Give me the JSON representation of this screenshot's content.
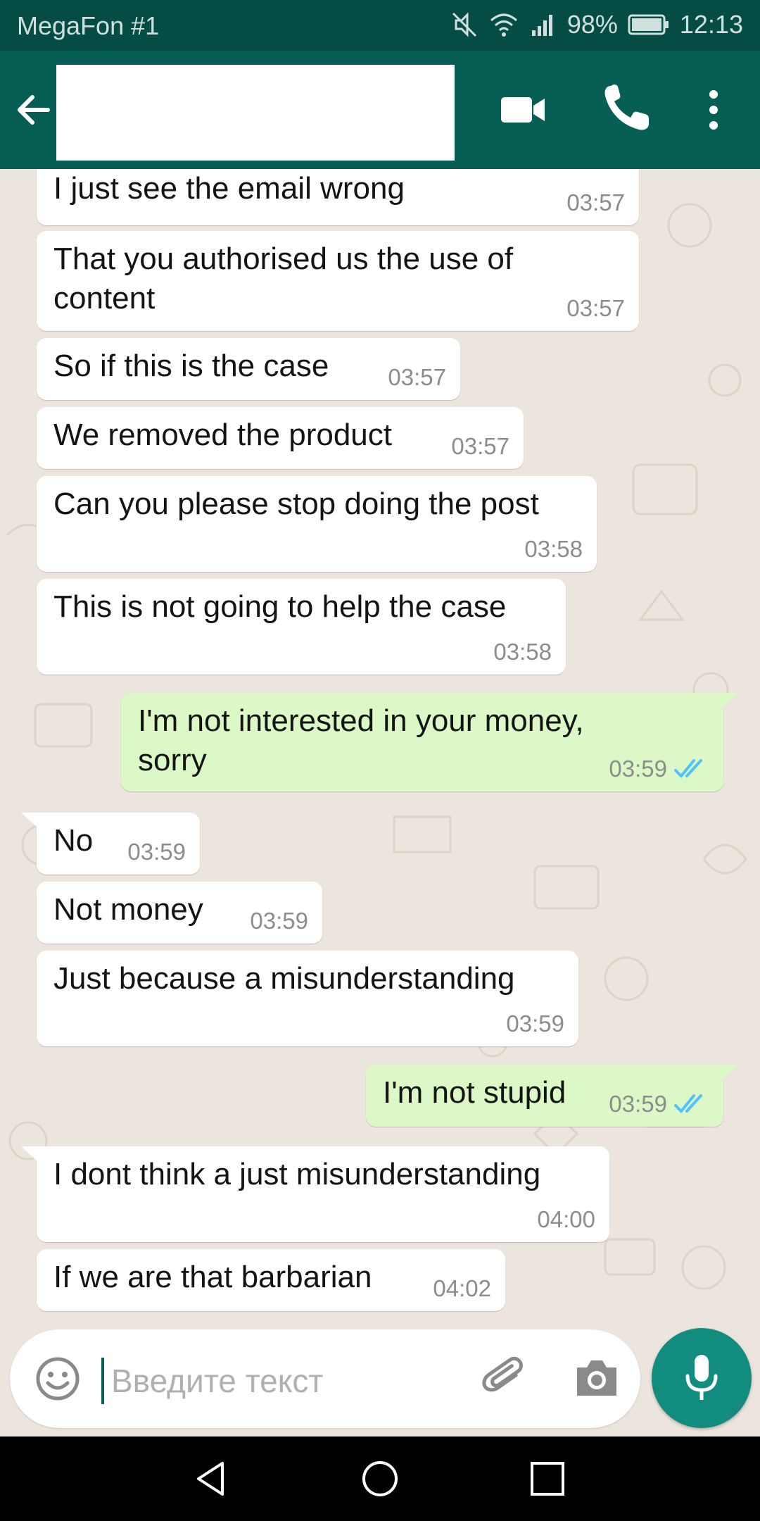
{
  "status_bar": {
    "carrier": "MegaFon #1",
    "battery": "98%",
    "time": "12:13"
  },
  "header": {
    "icons": [
      "back-arrow-icon",
      "video-call-icon",
      "phone-icon",
      "more-vert-icon"
    ]
  },
  "messages": [
    {
      "dir": "in",
      "text": "I just see the email wrong",
      "time": "03:57"
    },
    {
      "dir": "in",
      "text": "That you authorised us the use of content",
      "time": "03:57"
    },
    {
      "dir": "in",
      "text": "So if this is the case",
      "time": "03:57"
    },
    {
      "dir": "in",
      "text": "We removed the product",
      "time": "03:57"
    },
    {
      "dir": "in",
      "text": "Can you please stop doing the post",
      "time": "03:58"
    },
    {
      "dir": "in",
      "text": "This is not going to help the case",
      "time": "03:58"
    },
    {
      "dir": "out",
      "text": "I'm not interested in your money, sorry",
      "time": "03:59",
      "status": "read"
    },
    {
      "dir": "in",
      "text": "No",
      "time": "03:59"
    },
    {
      "dir": "in",
      "text": "Not money",
      "time": "03:59"
    },
    {
      "dir": "in",
      "text": "Just because a misunderstanding",
      "time": "03:59"
    },
    {
      "dir": "out",
      "text": "I'm not stupid",
      "time": "03:59",
      "status": "read"
    },
    {
      "dir": "in",
      "text": "I dont think a just misunderstanding",
      "time": "04:00"
    },
    {
      "dir": "in",
      "text": "If we are that barbarian",
      "time": "04:02"
    }
  ],
  "composer": {
    "placeholder": "Введите текст",
    "icons": [
      "emoji-icon",
      "attach-icon",
      "camera-icon",
      "mic-icon"
    ]
  },
  "colors": {
    "header": "#075e54",
    "status_bar": "#054d44",
    "chat_bg": "#ece5dd",
    "outgoing_bubble": "#dcf8c6",
    "incoming_bubble": "#ffffff",
    "read_ticks": "#4fc3f7",
    "mic_button": "#128c7e"
  }
}
